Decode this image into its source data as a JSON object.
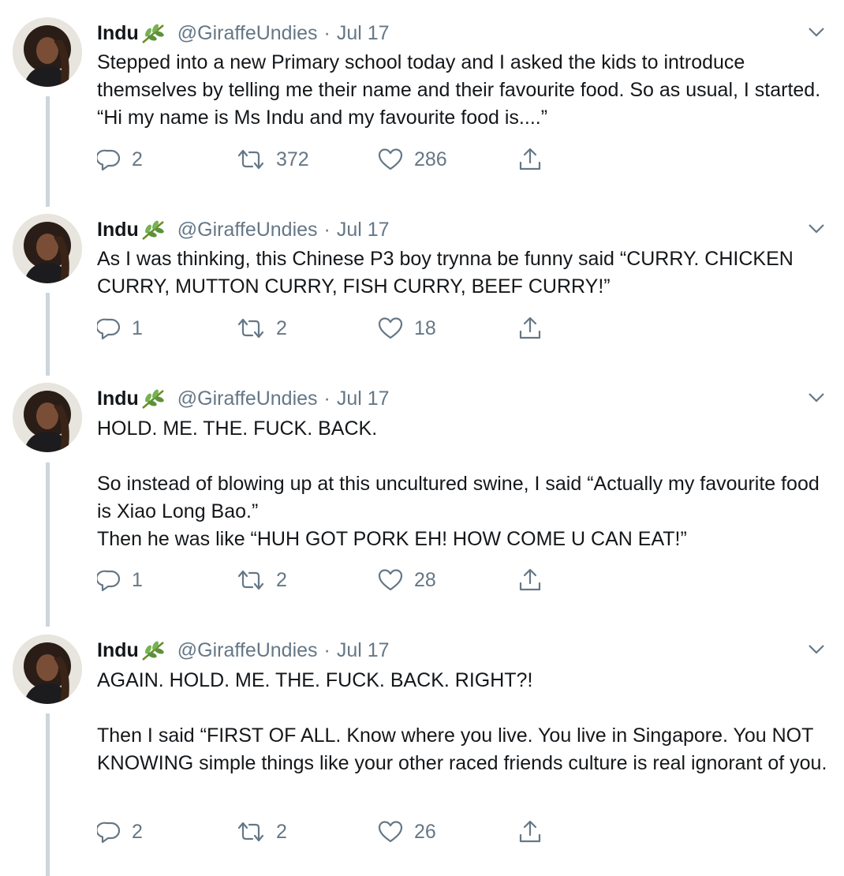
{
  "tweets": [
    {
      "name": "Indu",
      "handle": "@GiraffeUndies",
      "separator": "·",
      "date": "Jul 17",
      "text": "Stepped into a new Primary school today and I asked the kids to introduce themselves by telling me their name and their favourite food. So as usual, I started. “Hi my name is Ms Indu and my favourite food is....”",
      "replies": "2",
      "retweets": "372",
      "likes": "286"
    },
    {
      "name": "Indu",
      "handle": "@GiraffeUndies",
      "separator": "·",
      "date": "Jul 17",
      "text": "As I was thinking, this Chinese P3 boy trynna be funny said “CURRY. CHICKEN CURRY, MUTTON CURRY, FISH CURRY, BEEF CURRY!”",
      "replies": "1",
      "retweets": "2",
      "likes": "18"
    },
    {
      "name": "Indu",
      "handle": "@GiraffeUndies",
      "separator": "·",
      "date": "Jul 17",
      "text": "HOLD. ME. THE. FUCK. BACK.\n\nSo instead of blowing up at this uncultured swine, I said “Actually my favourite food is Xiao Long Bao.”\nThen he was like “HUH GOT PORK EH! HOW COME U CAN EAT!”",
      "replies": "1",
      "retweets": "2",
      "likes": "28"
    },
    {
      "name": "Indu",
      "handle": "@GiraffeUndies",
      "separator": "·",
      "date": "Jul 17",
      "text": "AGAIN. HOLD. ME. THE. FUCK. BACK. RIGHT?!\n\nThen I said “FIRST OF ALL. Know where you live. You live in Singapore. You NOT KNOWING simple things like your other raced friends culture is real ignorant of you.",
      "replies": "2",
      "retweets": "2",
      "likes": "26"
    }
  ],
  "icons": {
    "name_emoji": "herb-icon",
    "menu": "chevron-down-icon",
    "reply": "reply-icon",
    "retweet": "retweet-icon",
    "like": "heart-icon",
    "share": "share-icon"
  },
  "colors": {
    "text": "#14171a",
    "secondary": "#657786",
    "thread_line": "#ccd6dd",
    "background": "#ffffff"
  }
}
